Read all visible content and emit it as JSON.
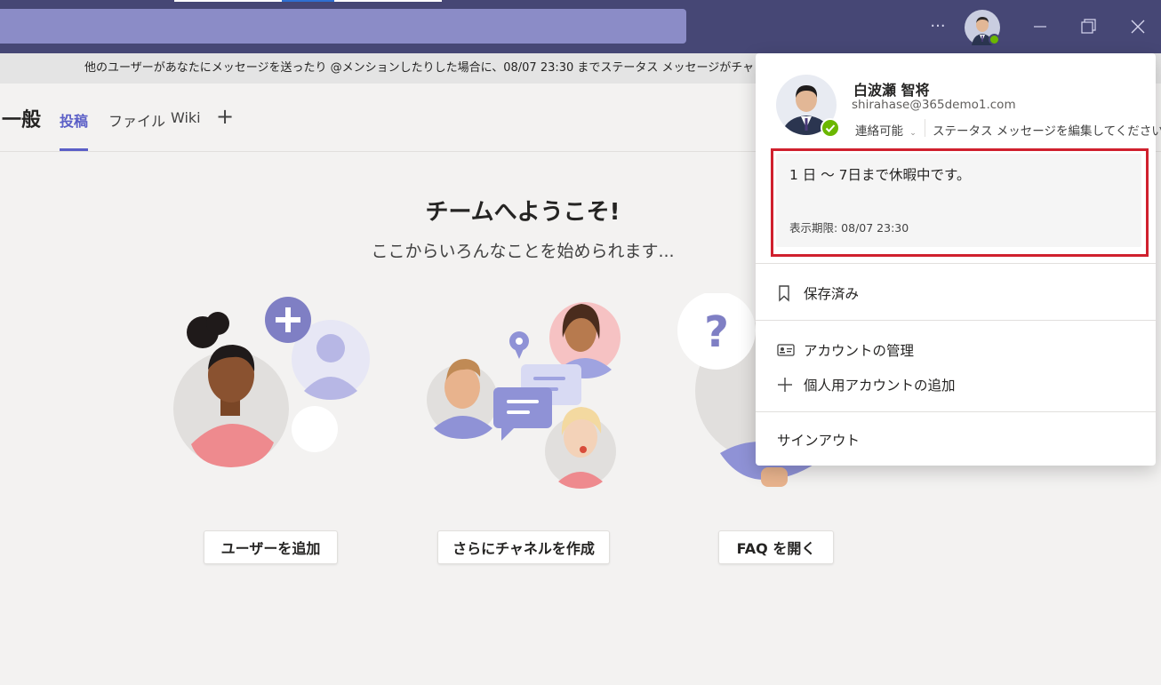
{
  "colors": {
    "titlebar": "#464775",
    "accent": "#5b5fc7",
    "highlight_border": "#d0202e",
    "presence_available": "#6bb700"
  },
  "titlebar": {
    "more_label": "···"
  },
  "banner": {
    "text": "他のユーザーがあなたにメッセージを送ったり @メンションしたりした場合に、08/07 23:30 までステータス メッセージがチャットとチャネル"
  },
  "channel": {
    "name": "一般",
    "tabs": [
      {
        "label": "投稿",
        "active": true
      },
      {
        "label": "ファイル",
        "active": false
      },
      {
        "label": "Wiki",
        "active": false
      }
    ],
    "add_tab": "+"
  },
  "welcome": {
    "title": "チームへようこそ!",
    "subtitle": "ここからいろんなことを始められます...",
    "buttons": [
      "ユーザーを追加",
      "さらにチャネルを作成",
      "FAQ を開く"
    ]
  },
  "profile": {
    "name": "白波瀬 智将",
    "email": "shirahase@365demo1.com",
    "presence": "連絡可能",
    "edit_status": "ステータス メッセージを編集してください",
    "status_message": "1 日 ～ 7日まで休暇中です。",
    "status_expiry": "表示期限: 08/07 23:30"
  },
  "menu": {
    "saved": "保存済み",
    "manage_account": "アカウントの管理",
    "add_personal": "個人用アカウントの追加",
    "sign_out": "サインアウト"
  }
}
